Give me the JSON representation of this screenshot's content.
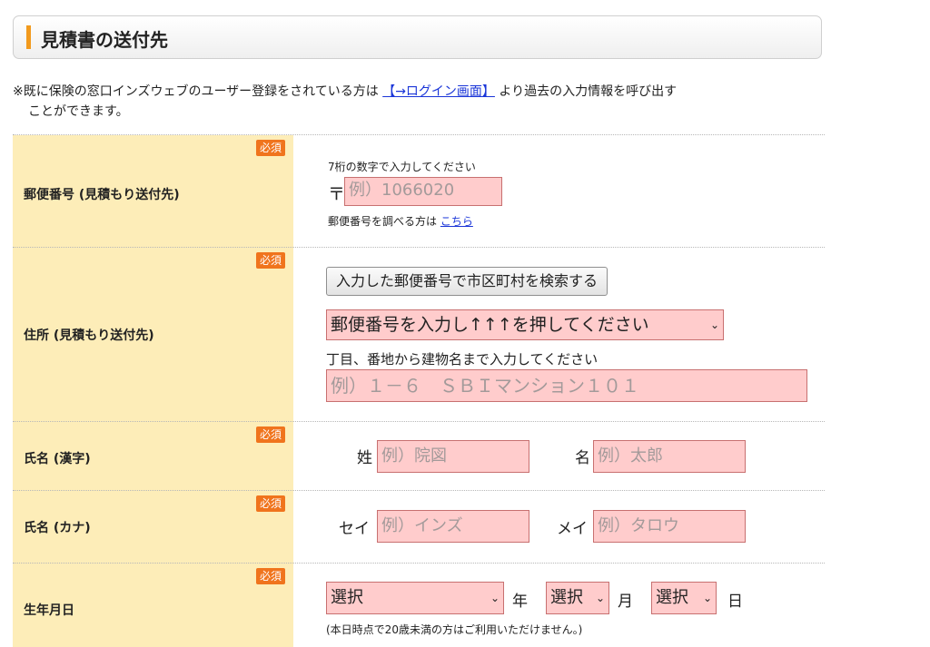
{
  "section": {
    "title": "見積書の送付先"
  },
  "notice": {
    "prefix": "※既に保険の窓口インズウェブのユーザー登録をされている方は",
    "link": "【→ログイン画面】",
    "suffix": "より過去の入力情報を呼び出す",
    "line2": "ことができます。"
  },
  "required_label": "必須",
  "postal": {
    "label": "郵便番号 (見積もり送付先)",
    "hint": "7桁の数字で入力してください",
    "mark": "〒",
    "placeholder": "例）1066020",
    "lookup_text": "郵便番号を調べる方は",
    "lookup_link": "こちら"
  },
  "address": {
    "label": "住所 (見積もり送付先)",
    "search_button": "入力した郵便番号で市区町村を検索する",
    "city_select": "郵便番号を入力し↑↑↑を押してください",
    "hint": "丁目、番地から建物名まで入力してください",
    "placeholder": "例）１－６　ＳＢＩマンション１０１"
  },
  "name_kanji": {
    "label": "氏名 (漢字)",
    "last_label": "姓",
    "last_placeholder": "例）院図",
    "first_label": "名",
    "first_placeholder": "例）太郎"
  },
  "name_kana": {
    "label": "氏名 (カナ)",
    "last_label": "セイ",
    "last_placeholder": "例）インズ",
    "first_label": "メイ",
    "first_placeholder": "例）タロウ"
  },
  "birthdate": {
    "label": "生年月日",
    "year_select": "選択",
    "year_unit": "年",
    "month_select": "選択",
    "month_unit": "月",
    "day_select": "選択",
    "day_unit": "日",
    "note": "(本日時点で20歳未満の方はご利用いただけません。)"
  },
  "colors": {
    "accent": "#f29a1d",
    "required": "#f0741d",
    "header_bg": "#fdedb8",
    "input_bg": "#ffcccc",
    "link": "#1a35d8"
  },
  "icons": {
    "select_arrow": "chevron-down-icon"
  }
}
